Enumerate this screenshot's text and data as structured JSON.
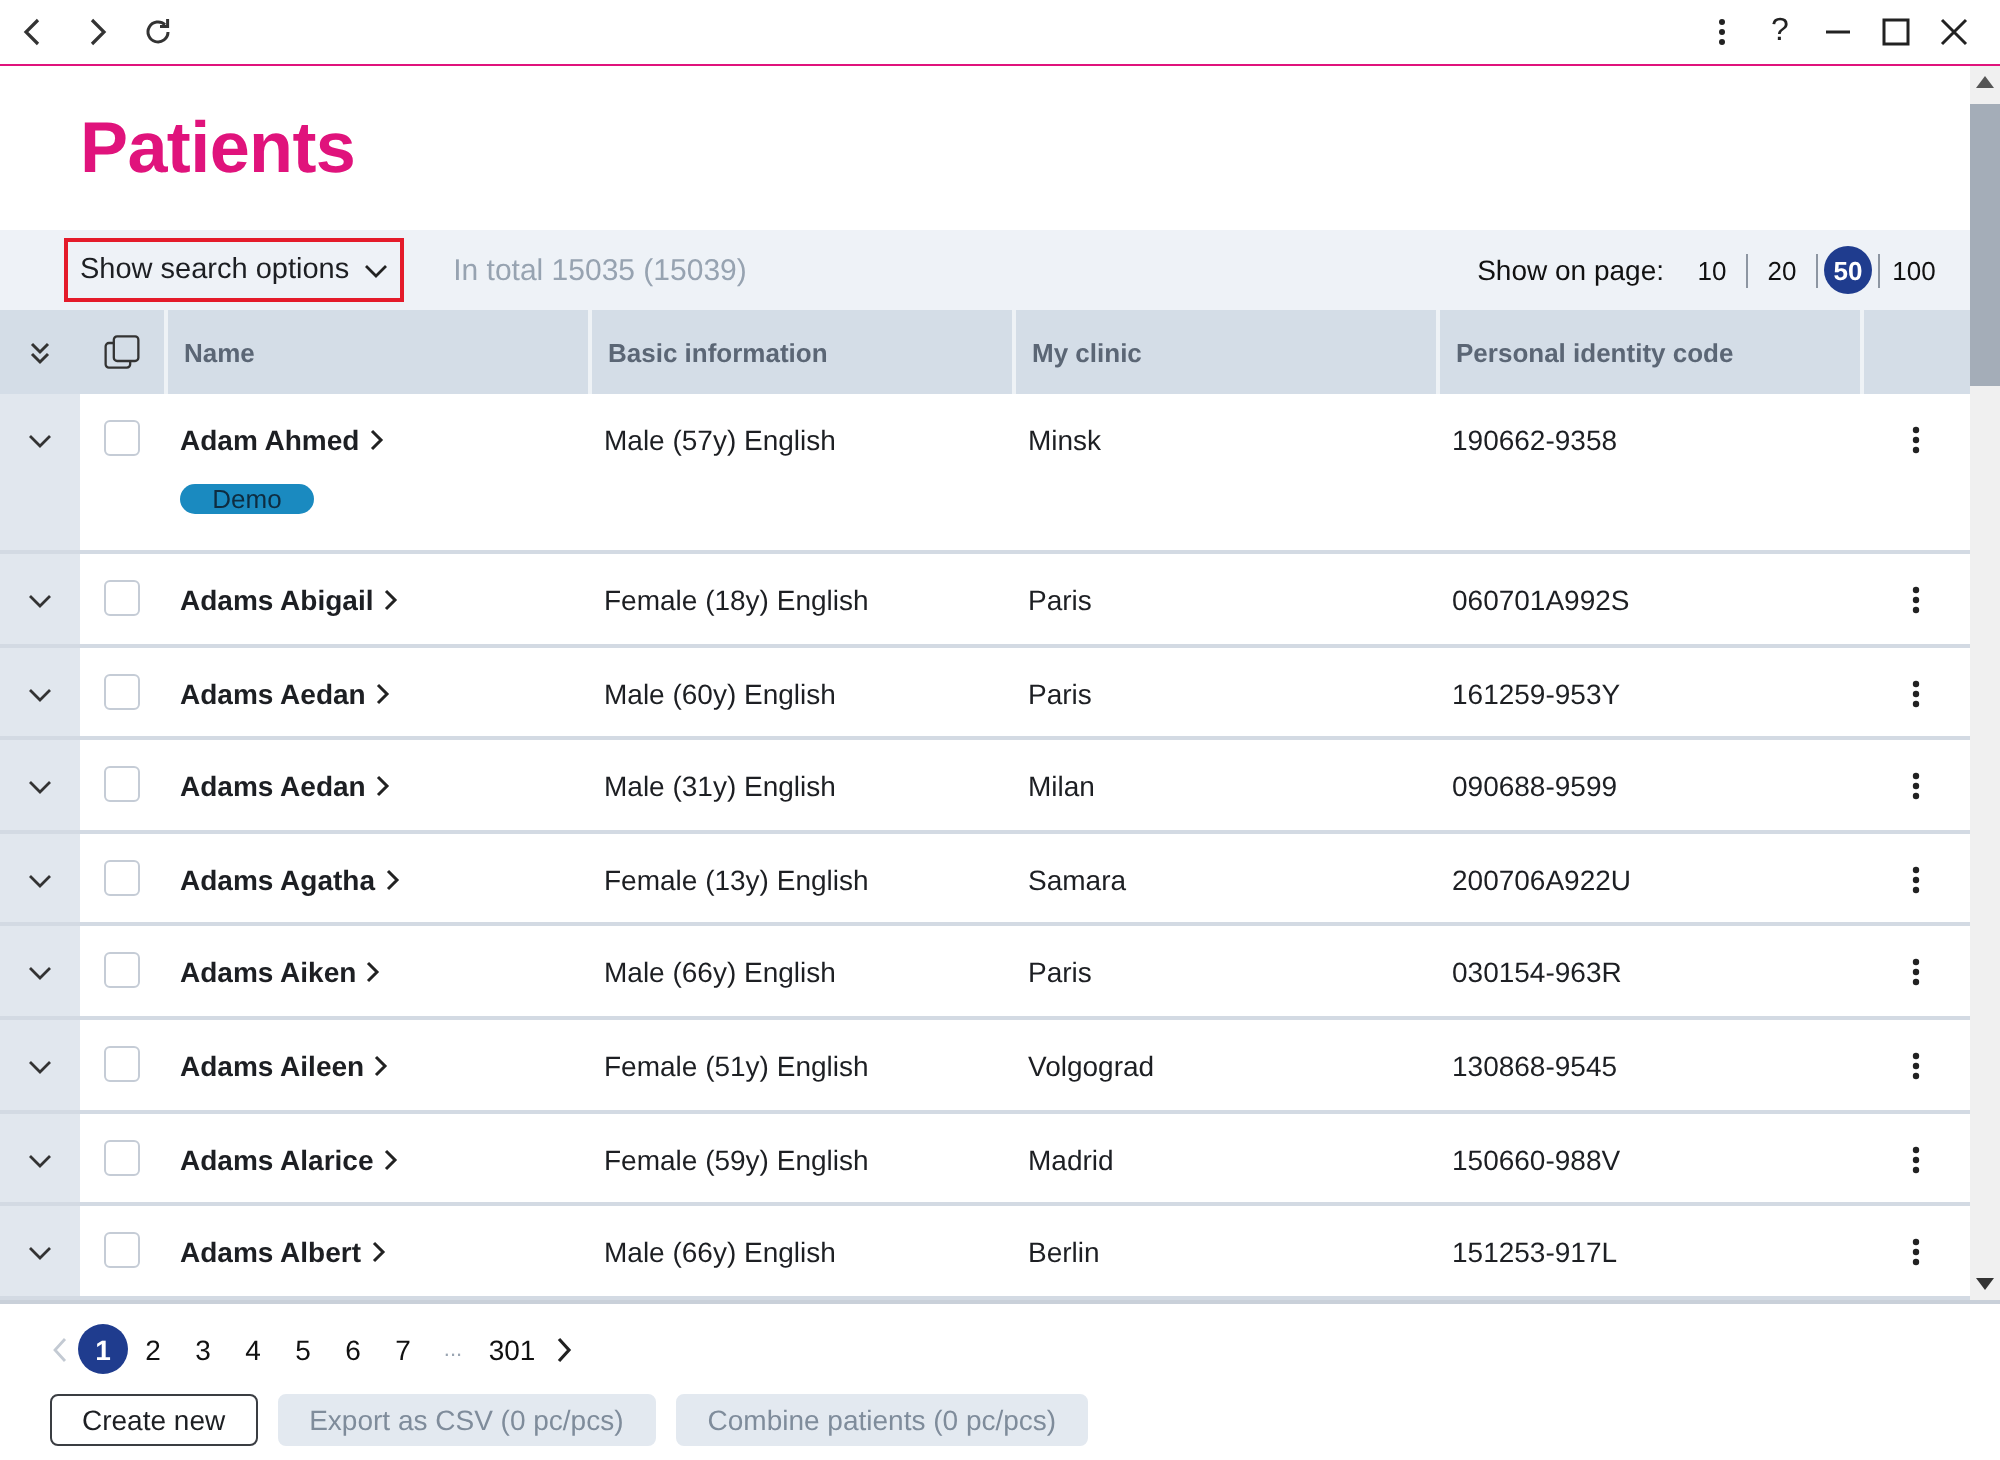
{
  "window": {
    "help": "?"
  },
  "page": {
    "title": "Patients"
  },
  "search_bar": {
    "toggle": {
      "label": "Show search options",
      "highlighted": true
    },
    "total": "In total 15035 (15039)",
    "page_size_label": "Show on page:",
    "page_sizes": [
      {
        "label": "10",
        "selected": false
      },
      {
        "label": "20",
        "selected": false
      },
      {
        "label": "50",
        "selected": true
      },
      {
        "label": "100",
        "selected": false
      }
    ]
  },
  "table": {
    "columns": [
      "Name",
      "Basic information",
      "My clinic",
      "Personal identity code"
    ],
    "rows": [
      {
        "name": "Adam Ahmed",
        "tags": [
          "Demo"
        ],
        "basic_info": "Male (57y) English",
        "clinic": "Minsk",
        "identity_code": "190662-9358",
        "checked": false,
        "expanded": false
      },
      {
        "name": "Adams Abigail",
        "basic_info": "Female (18y) English",
        "clinic": "Paris",
        "identity_code": "060701A992S",
        "checked": false,
        "expanded": false
      },
      {
        "name": "Adams Aedan",
        "basic_info": "Male (60y) English",
        "clinic": "Paris",
        "identity_code": "161259-953Y",
        "checked": false,
        "expanded": false
      },
      {
        "name": "Adams Aedan",
        "basic_info": "Male (31y) English",
        "clinic": "Milan",
        "identity_code": "090688-9599",
        "checked": false,
        "expanded": false
      },
      {
        "name": "Adams Agatha",
        "basic_info": "Female (13y) English",
        "clinic": "Samara",
        "identity_code": "200706A922U",
        "checked": false,
        "expanded": false
      },
      {
        "name": "Adams Aiken",
        "basic_info": "Male (66y) English",
        "clinic": "Paris",
        "identity_code": "030154-963R",
        "checked": false,
        "expanded": false
      },
      {
        "name": "Adams Aileen",
        "basic_info": "Female (51y) English",
        "clinic": "Volgograd",
        "identity_code": "130868-9545",
        "checked": false,
        "expanded": false
      },
      {
        "name": "Adams Alarice",
        "basic_info": "Female (59y) English",
        "clinic": "Madrid",
        "identity_code": "150660-988V",
        "checked": false,
        "expanded": false
      },
      {
        "name": "Adams Albert",
        "basic_info": "Male (66y) English",
        "clinic": "Berlin",
        "identity_code": "151253-917L",
        "checked": false,
        "expanded": false
      }
    ]
  },
  "pagination": {
    "previous_disabled": true,
    "pages": [
      {
        "kind": "page",
        "label": "1",
        "selected": true
      },
      {
        "kind": "page",
        "label": "2",
        "selected": false
      },
      {
        "kind": "page",
        "label": "3",
        "selected": false
      },
      {
        "kind": "page",
        "label": "4",
        "selected": false
      },
      {
        "kind": "page",
        "label": "5",
        "selected": false
      },
      {
        "kind": "page",
        "label": "6",
        "selected": false
      },
      {
        "kind": "page",
        "label": "7",
        "selected": false
      },
      {
        "kind": "ellipsis",
        "label": "..."
      },
      {
        "kind": "page",
        "label": "301",
        "selected": false
      }
    ]
  },
  "buttons": [
    {
      "label": "Create new",
      "disabled": false
    },
    {
      "label": "Export as CSV (0 pc/pcs)",
      "disabled": true
    },
    {
      "label": "Combine patients (0 pc/pcs)",
      "disabled": true
    }
  ]
}
